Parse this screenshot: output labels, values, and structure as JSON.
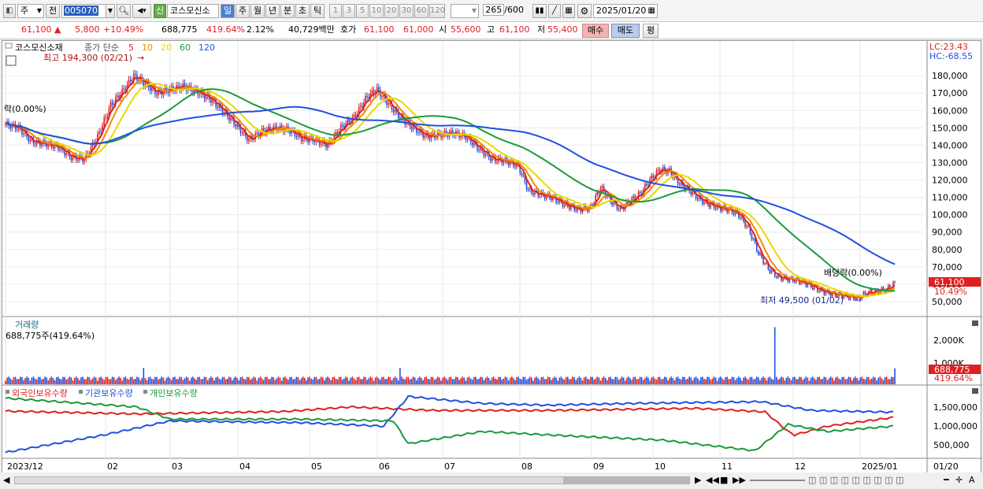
{
  "toolbar": {
    "period_unit": "주",
    "prev_label": "전",
    "code": "005070",
    "new_badge": "신",
    "stock_name": "코스모신소",
    "periods": [
      "일",
      "주",
      "월",
      "년",
      "분",
      "초",
      "틱"
    ],
    "active_period": "일",
    "intervals": [
      "1",
      "3",
      "5",
      "10",
      "20",
      "30",
      "60",
      "120"
    ],
    "count": "265",
    "count_total": "/600",
    "date": "2025/01/20"
  },
  "quote": {
    "price": "61,100",
    "change": "5,800",
    "change_pct": "+10.49%",
    "volume": "688,775",
    "volume_ratio": "419.64%",
    "turnover": "2.12%",
    "amount": "40,729백만",
    "bid_label": "호가",
    "bid": "61,100",
    "ask": "61,000",
    "open_label": "시",
    "open": "55,600",
    "high_label": "고",
    "high": "61,100",
    "low_label": "저",
    "low": "55,400",
    "buy_label": "매수",
    "sell_label": "매도",
    "eval_label": "평"
  },
  "price_panel": {
    "name": "코스모신소재",
    "ma_label": "종가 단순",
    "ma_periods": [
      "5",
      "10",
      "20",
      "60",
      "120"
    ],
    "ma_colors": [
      "#e02020",
      "#f08c00",
      "#e8d800",
      "#1a9a3c",
      "#2050e0"
    ],
    "high_note": "최고 194,300 (02/21)",
    "low_note": "최저 49,500 (01/02)",
    "ex_right_left": "락(0.00%)",
    "ex_dividend": "배당락(0.00%)",
    "lc": "LC:23.43",
    "hc": "HC:-68.55",
    "price_tag": "61,100",
    "pct_tag": "10.49%",
    "y_ticks": [
      "180,000",
      "170,000",
      "160,000",
      "150,000",
      "140,000",
      "130,000",
      "120,000",
      "110,000",
      "100,000",
      "90,000",
      "80,000",
      "70,000",
      "60,000",
      "50,000"
    ]
  },
  "volume_panel": {
    "title": "거래량",
    "info": "688,775주(419.64%)",
    "y_ticks": [
      "2,000K",
      "1,000K"
    ],
    "tag": "688,775",
    "tag_pct": "419.64%"
  },
  "holdings_panel": {
    "series": [
      "외국인보유수량",
      "기관보유수량",
      "개인보유수량"
    ],
    "colors": [
      "#e02020",
      "#2050e0",
      "#1a9a3c"
    ],
    "y_ticks": [
      "1,500,000",
      "1,000,000",
      "500,000"
    ]
  },
  "x_axis": [
    "2023/12",
    "02",
    "03",
    "04",
    "05",
    "06",
    "07",
    "08",
    "09",
    "10",
    "11",
    "12",
    "2025/01"
  ],
  "x_axis_right": "01/20",
  "chart_data": {
    "type": "line",
    "price_range": [
      45000,
      195000
    ],
    "close_points": [
      [
        0,
        152000
      ],
      [
        8,
        150000
      ],
      [
        16,
        142000
      ],
      [
        24,
        141000
      ],
      [
        32,
        139000
      ],
      [
        40,
        133000
      ],
      [
        48,
        132000
      ],
      [
        56,
        145000
      ],
      [
        64,
        163000
      ],
      [
        72,
        172000
      ],
      [
        78,
        180000
      ],
      [
        84,
        176000
      ],
      [
        92,
        170000
      ],
      [
        100,
        172000
      ],
      [
        108,
        174000
      ],
      [
        116,
        171000
      ],
      [
        124,
        167000
      ],
      [
        132,
        160000
      ],
      [
        140,
        152000
      ],
      [
        148,
        143000
      ],
      [
        156,
        148000
      ],
      [
        164,
        150000
      ],
      [
        172,
        149000
      ],
      [
        180,
        144000
      ],
      [
        188,
        143000
      ],
      [
        196,
        140000
      ],
      [
        204,
        150000
      ],
      [
        212,
        156000
      ],
      [
        220,
        168000
      ],
      [
        226,
        172000
      ],
      [
        232,
        165000
      ],
      [
        240,
        156000
      ],
      [
        248,
        150000
      ],
      [
        256,
        145000
      ],
      [
        264,
        146000
      ],
      [
        272,
        147000
      ],
      [
        280,
        145000
      ],
      [
        288,
        138000
      ],
      [
        296,
        132000
      ],
      [
        304,
        131000
      ],
      [
        312,
        128000
      ],
      [
        318,
        114000
      ],
      [
        324,
        112000
      ],
      [
        332,
        110000
      ],
      [
        340,
        106000
      ],
      [
        348,
        103000
      ],
      [
        356,
        104000
      ],
      [
        362,
        116000
      ],
      [
        368,
        108000
      ],
      [
        374,
        103000
      ],
      [
        380,
        108000
      ],
      [
        386,
        112000
      ],
      [
        392,
        120000
      ],
      [
        398,
        126000
      ],
      [
        404,
        125000
      ],
      [
        410,
        118000
      ],
      [
        416,
        114000
      ],
      [
        422,
        109000
      ],
      [
        428,
        106000
      ],
      [
        434,
        104000
      ],
      [
        440,
        103000
      ],
      [
        446,
        100000
      ],
      [
        452,
        92000
      ],
      [
        458,
        78000
      ],
      [
        464,
        69000
      ],
      [
        470,
        64000
      ],
      [
        476,
        63000
      ],
      [
        482,
        62000
      ],
      [
        488,
        60000
      ],
      [
        494,
        57000
      ],
      [
        500,
        55000
      ],
      [
        506,
        54000
      ],
      [
        512,
        53000
      ],
      [
        518,
        52000
      ],
      [
        524,
        55000
      ],
      [
        530,
        56000
      ],
      [
        536,
        57000
      ],
      [
        541,
        61100
      ]
    ],
    "vol_max": 2500000
  }
}
